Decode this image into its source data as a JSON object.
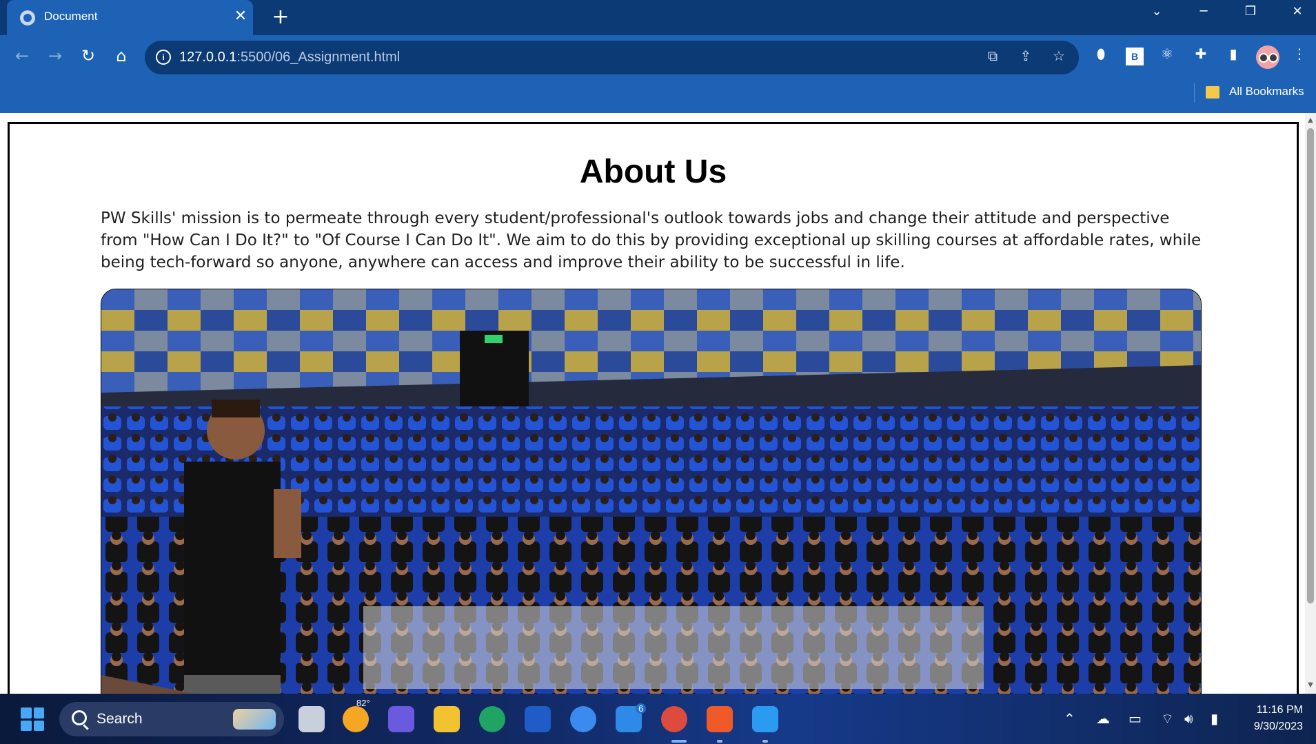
{
  "browser": {
    "tab_title": "Document",
    "tab_close": "✕",
    "new_tab": "+",
    "url_host": "127.0.0.1",
    "url_rest": ":5500/06_Assignment.html",
    "bookmarks_label": "All Bookmarks",
    "extension_b": "B"
  },
  "page": {
    "heading": "About Us",
    "paragraph": "PW Skills' mission is to permeate through every student/professional's outlook towards jobs and change their attitude and perspective from \"How Can I Do It?\" to \"Of Course I Can Do It\". We aim to do this by providing exceptional up skilling courses at affordable rates, while being tech-forward so anyone, anywhere can access and improve their ability to be successful in life.",
    "hero_image": "auditorium-photo"
  },
  "taskbar": {
    "search_label": "Search",
    "weather_temp": "82°",
    "mail_badge": "6",
    "time": "11:16 PM",
    "date": "9/30/2023"
  },
  "colors": {
    "tabbar": "#0b3a75",
    "toolbar": "#1d62b5",
    "seat_blue": "#1f4fc8"
  }
}
